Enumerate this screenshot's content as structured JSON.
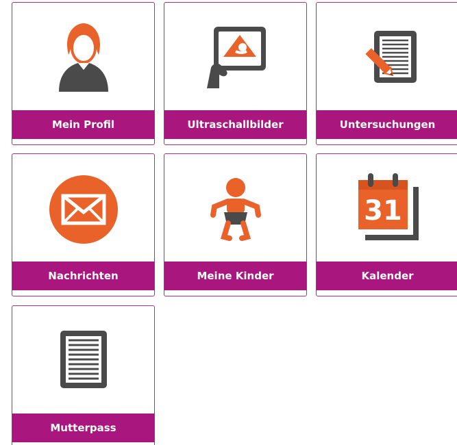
{
  "tiles": [
    {
      "label": "Mein Profil",
      "icon": "profile-icon"
    },
    {
      "label": "Ultraschallbilder",
      "icon": "ultrasound-icon"
    },
    {
      "label": "Untersuchungen",
      "icon": "examination-notes-icon"
    },
    {
      "label": "Nachrichten",
      "icon": "envelope-icon"
    },
    {
      "label": "Meine Kinder",
      "icon": "baby-icon"
    },
    {
      "label": "Kalender",
      "icon": "calendar-icon",
      "icon_text": "31"
    },
    {
      "label": "Mutterpass",
      "icon": "document-icon"
    }
  ],
  "colors": {
    "accent": "#a8167e",
    "orange": "#e8622a",
    "gray": "#4a4a4a"
  }
}
